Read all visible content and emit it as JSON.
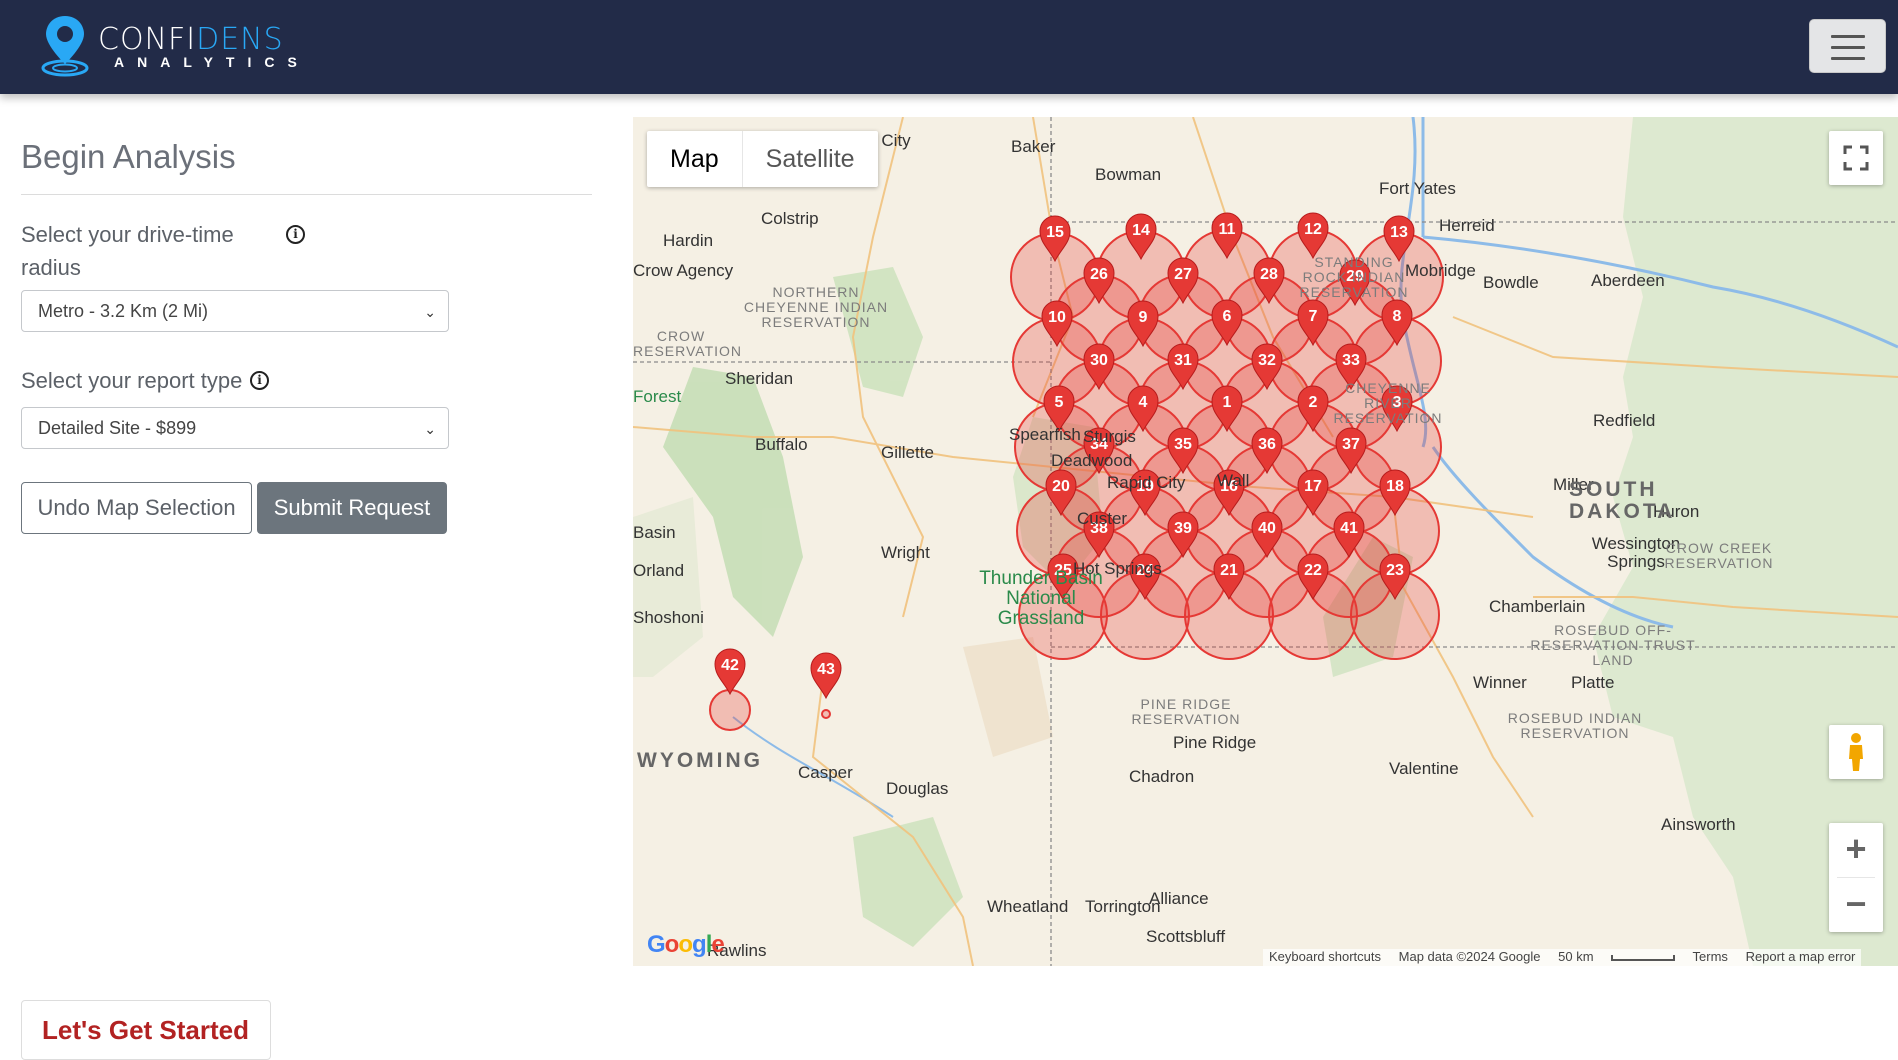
{
  "header": {
    "brand_main": "CONFI",
    "brand_accent": "DENS",
    "brand_sub": "ANALYTICS",
    "menu_icon": "hamburger-menu-icon",
    "colors": {
      "bar": "#222b48",
      "accent": "#29a8f5"
    }
  },
  "form": {
    "title": "Begin Analysis",
    "radius_label": "Select your drive-time radius",
    "radius_value": "Metro - 3.2 Km (2 Mi)",
    "report_label": "Select your report type",
    "report_value": "Detailed Site - $899",
    "undo_label": "Undo Map Selection",
    "submit_label": "Submit Request",
    "card_title": "Let's Get Started"
  },
  "map": {
    "type_map": "Map",
    "type_satellite": "Satellite",
    "zoom_in": "+",
    "zoom_out": "−",
    "logo": "Google",
    "attribution": {
      "shortcuts": "Keyboard shortcuts",
      "data": "Map data ©2024 Google",
      "scale": "50 km",
      "terms": "Terms",
      "report": "Report a map error"
    },
    "marker_color": "#e53935",
    "markers": [
      "1",
      "2",
      "3",
      "4",
      "5",
      "6",
      "7",
      "8",
      "9",
      "10",
      "11",
      "12",
      "13",
      "14",
      "15",
      "16",
      "17",
      "18",
      "19",
      "20",
      "21",
      "22",
      "23",
      "24",
      "25",
      "26",
      "27",
      "28",
      "29",
      "30",
      "31",
      "32",
      "33",
      "34",
      "35",
      "36",
      "37",
      "38",
      "39",
      "40",
      "41",
      "42",
      "43"
    ],
    "places": [
      "Miles City",
      "Baker",
      "Bowman",
      "Fort Yates",
      "Herreid",
      "Mobridge",
      "Bowdle",
      "Aberdeen",
      "Colstrip",
      "Hardin",
      "Crow Agency",
      "Sheridan",
      "Buffalo",
      "Gillette",
      "Spearfish",
      "Sturgis",
      "Deadwood",
      "Rapid City",
      "Wall",
      "Custer",
      "Hot Springs",
      "Wright",
      "Shoshoni",
      "Casper",
      "Douglas",
      "Chadron",
      "Pine Ridge",
      "Valentine",
      "Winner",
      "Platte",
      "Chamberlain",
      "Miller",
      "Redfield",
      "Huron",
      "Wessington Springs",
      "Ainsworth",
      "Alliance",
      "Scottsbluff",
      "Torrington",
      "Wheatland",
      "Rawlins",
      "Orland",
      "Forest",
      "Basin"
    ],
    "regions": [
      "NORTHERN CHEYENNE INDIAN RESERVATION",
      "CROW RESERVATION",
      "STANDING ROCK INDIAN RESERVATION",
      "CHEYENNE RIVER RESERVATION",
      "CROW CREEK RESERVATION",
      "ROSEBUD OFF-RESERVATION TRUST LAND",
      "ROSEBUD INDIAN RESERVATION",
      "PINE RIDGE RESERVATION"
    ],
    "states": [
      "WYOMING",
      "SOUTH DAKOTA"
    ],
    "parks": [
      "Thunder Basin National Grassland"
    ]
  }
}
